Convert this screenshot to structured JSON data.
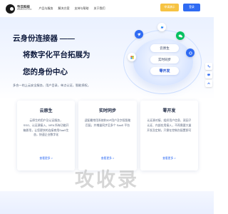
{
  "header": {
    "logo_name": "竹云科技",
    "logo_sub": "BAMBOOCLOUD",
    "nav": [
      "产品与服务",
      "解决方案",
      "支持与帮助",
      "关于我们"
    ],
    "demo_label": "申请演示",
    "login_label": "登录"
  },
  "hero": {
    "line1": "云身份连接器 ——",
    "line2": "将数字化平台拓展为",
    "line3": "您的身份中心",
    "desc": "多合一的上云安全服务，用户目录，单点认证，智能授权。",
    "chips": [
      "云原生",
      "实时同步",
      "零开发"
    ]
  },
  "cards": [
    {
      "title": "云原生",
      "lines": [
        "云原生的用户及认证服务，",
        "SSO、认证源接入、MFA 所有功能开",
        "箱即用，让您更快的连接商用SaaS生",
        "态，快速企业数字化"
      ],
      "link": "查看更多 >"
    },
    {
      "title": "实时同步",
      "lines": [
        "适配最常用系统和IDP用户及字段智能",
        "匹配，并增量同步至多个 SaaS 平台"
      ],
      "link": "查看更多 >"
    },
    {
      "title": "零开发",
      "lines": [
        "认证源对接、组织用户信息、双因子",
        "认证、内部应用接入，不再需要大量",
        "开发及定制，只需在控制台配置即可"
      ],
      "link": "查看更多 >"
    }
  ],
  "watermark": "攻收录",
  "colors": {
    "primary": "#2f6bf3",
    "accent": "#f6c343",
    "heading": "#0f1b3d"
  }
}
